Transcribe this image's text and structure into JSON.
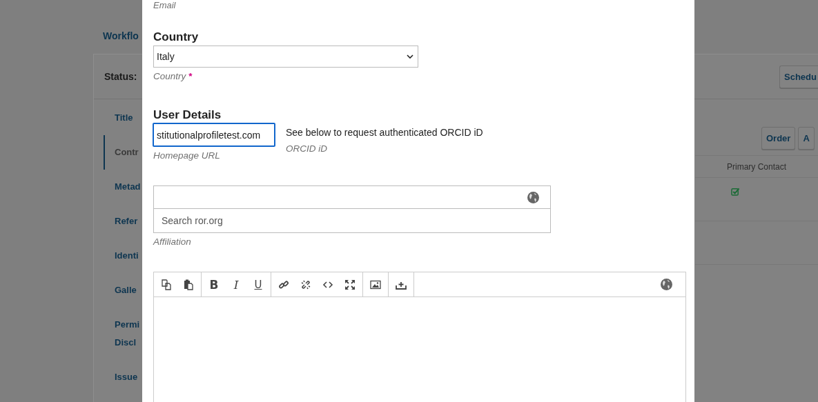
{
  "background": {
    "tab": "Workflo",
    "status_label": "Status:",
    "sidebar": [
      {
        "lines": [
          "Title"
        ],
        "selected": false
      },
      {
        "lines": [
          "Contr"
        ],
        "selected": true
      },
      {
        "lines": [
          "Metad"
        ],
        "selected": false
      },
      {
        "lines": [
          "Refer"
        ],
        "selected": false
      },
      {
        "lines": [
          "Identi"
        ],
        "selected": false
      },
      {
        "lines": [
          "Galle"
        ],
        "selected": false
      },
      {
        "lines": [
          "Permi",
          "Discl"
        ],
        "selected": false
      },
      {
        "lines": [
          "Issue"
        ],
        "selected": false
      }
    ],
    "header_button": "Schedu",
    "contributor_buttons": [
      "Order",
      "A"
    ],
    "table": {
      "columns": [
        "Primary Contact"
      ],
      "rows": [
        {
          "primary_contact": true
        },
        {
          "primary_contact": false
        }
      ]
    }
  },
  "modal": {
    "email_label": "Email",
    "country": {
      "heading": "Country",
      "value": "Italy",
      "label": "Country",
      "required": true,
      "required_mark": "*"
    },
    "user_details": {
      "heading": "User Details",
      "homepage": {
        "value": "stitutionalprofiletest.com",
        "label": "Homepage URL",
        "focused": true
      },
      "orcid": {
        "text": "See below to request authenticated ORCID iD",
        "label": "ORCID iD"
      }
    },
    "affiliation": {
      "placeholder": "Search ror.org",
      "label": "Affiliation"
    },
    "editor": {
      "toolbar_groups": [
        [
          {
            "kind": "copy"
          },
          {
            "kind": "paste"
          }
        ],
        [
          {
            "kind": "bold",
            "label": "B"
          },
          {
            "kind": "italic",
            "label": "I"
          },
          {
            "kind": "underline",
            "label": "U"
          }
        ],
        [
          {
            "kind": "link"
          },
          {
            "kind": "unlink"
          },
          {
            "kind": "code"
          },
          {
            "kind": "fullscreen"
          }
        ],
        [
          {
            "kind": "image"
          }
        ],
        [
          {
            "kind": "upload"
          }
        ]
      ]
    }
  }
}
